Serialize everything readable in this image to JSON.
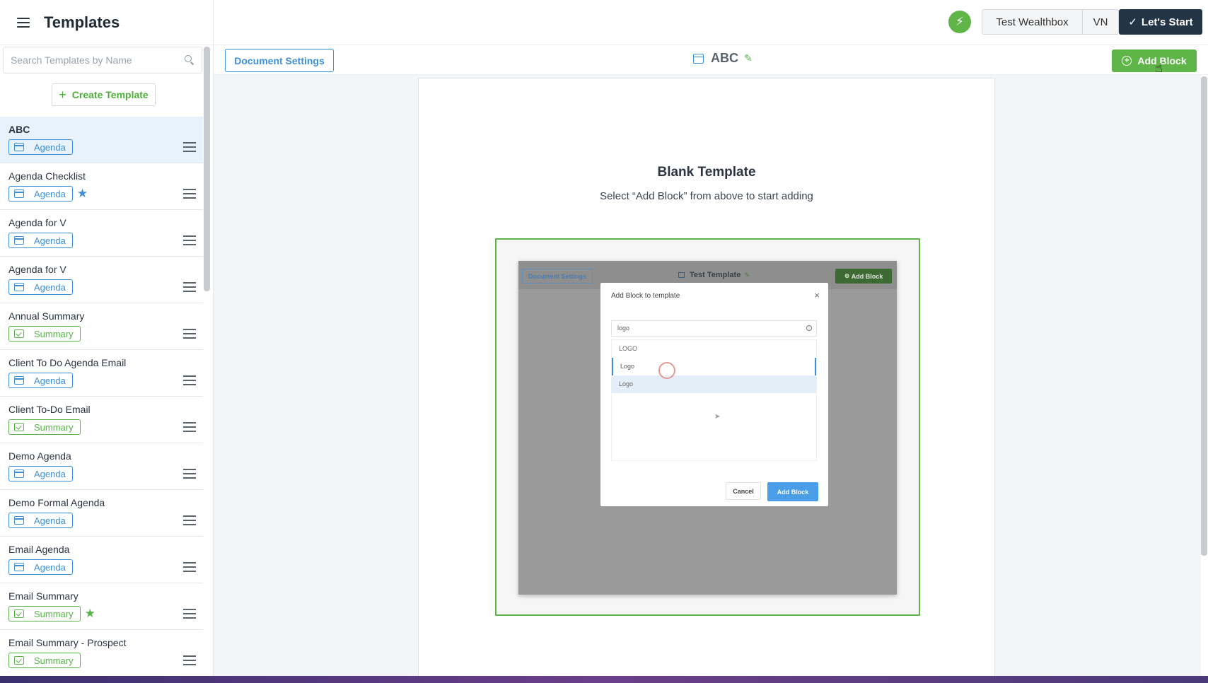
{
  "sidebar": {
    "title": "Templates",
    "search_placeholder": "Search Templates by Name",
    "create_label": "Create Template",
    "items": [
      {
        "name": "ABC",
        "tag": "Agenda",
        "type": "agenda",
        "starred": false,
        "active": true
      },
      {
        "name": "Agenda Checklist",
        "tag": "Agenda",
        "type": "agenda",
        "starred": "blue",
        "active": false
      },
      {
        "name": "Agenda for V",
        "tag": "Agenda",
        "type": "agenda",
        "starred": false,
        "active": false
      },
      {
        "name": "Agenda for V",
        "tag": "Agenda",
        "type": "agenda",
        "starred": false,
        "active": false
      },
      {
        "name": "Annual Summary",
        "tag": "Summary",
        "type": "summary",
        "starred": false,
        "active": false
      },
      {
        "name": "Client To Do Agenda Email",
        "tag": "Agenda",
        "type": "agenda",
        "starred": false,
        "active": false
      },
      {
        "name": "Client To-Do Email",
        "tag": "Summary",
        "type": "summary",
        "starred": false,
        "active": false
      },
      {
        "name": "Demo Agenda",
        "tag": "Agenda",
        "type": "agenda",
        "starred": false,
        "active": false
      },
      {
        "name": "Demo Formal Agenda",
        "tag": "Agenda",
        "type": "agenda",
        "starred": false,
        "active": false
      },
      {
        "name": "Email Agenda",
        "tag": "Agenda",
        "type": "agenda",
        "starred": false,
        "active": false
      },
      {
        "name": "Email Summary",
        "tag": "Summary",
        "type": "summary",
        "starred": "green",
        "active": false
      },
      {
        "name": "Email Summary - Prospect",
        "tag": "Summary",
        "type": "summary",
        "starred": false,
        "active": false
      }
    ]
  },
  "header": {
    "crm_label": "Test Wealthbox",
    "user_initials": "VN",
    "start_label": "Let's Start"
  },
  "toolbar": {
    "doc_settings_label": "Document Settings",
    "doc_title": "ABC",
    "add_block_label": "Add Block"
  },
  "canvas": {
    "blank_title": "Blank Template",
    "blank_subtitle": "Select “Add Block” from above to start adding"
  },
  "preview": {
    "doc_settings_label": "Document Settings",
    "title": "Test Template",
    "add_block_label": "Add Block",
    "modal_title": "Add Block to template",
    "search_value": "logo",
    "results": [
      "LOGO",
      "Logo",
      "Logo"
    ],
    "cancel_label": "Cancel",
    "add_label": "Add Block"
  },
  "colors": {
    "accent_green": "#5fb547",
    "accent_blue": "#3d8fd6",
    "dark_navy": "#243447"
  }
}
